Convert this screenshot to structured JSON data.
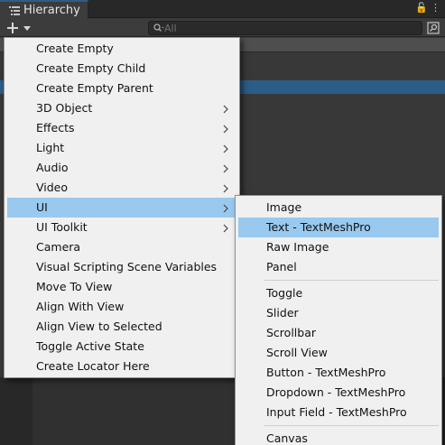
{
  "window": {
    "tab_title": "Hierarchy",
    "lock_symbol": "🔓",
    "more_symbol": "⋮"
  },
  "toolbar": {
    "search_placeholder": "All"
  },
  "colors": {
    "menu_bg": "#f0f0f0",
    "highlight": "#99c9ef",
    "selection_blue": "#2c5d87",
    "editor_bg": "#383838"
  },
  "main_menu": {
    "items": [
      {
        "label": "Create Empty",
        "has_submenu": false
      },
      {
        "label": "Create Empty Child",
        "has_submenu": false
      },
      {
        "label": "Create Empty Parent",
        "has_submenu": false
      },
      {
        "label": "3D Object",
        "has_submenu": true
      },
      {
        "label": "Effects",
        "has_submenu": true
      },
      {
        "label": "Light",
        "has_submenu": true
      },
      {
        "label": "Audio",
        "has_submenu": true
      },
      {
        "label": "Video",
        "has_submenu": true
      },
      {
        "label": "UI",
        "has_submenu": true,
        "highlighted": true
      },
      {
        "label": "UI Toolkit",
        "has_submenu": true
      },
      {
        "label": "Camera",
        "has_submenu": false
      },
      {
        "label": "Visual Scripting Scene Variables",
        "has_submenu": false
      },
      {
        "label": "Move To View",
        "has_submenu": false
      },
      {
        "label": "Align With View",
        "has_submenu": false
      },
      {
        "label": "Align View to Selected",
        "has_submenu": false
      },
      {
        "label": "Toggle Active State",
        "has_submenu": false
      },
      {
        "label": "Create Locator Here",
        "has_submenu": false
      }
    ]
  },
  "ui_submenu": {
    "groups": [
      [
        {
          "label": "Image"
        },
        {
          "label": "Text - TextMeshPro",
          "highlighted": true
        },
        {
          "label": "Raw Image"
        },
        {
          "label": "Panel"
        }
      ],
      [
        {
          "label": "Toggle"
        },
        {
          "label": "Slider"
        },
        {
          "label": "Scrollbar"
        },
        {
          "label": "Scroll View"
        },
        {
          "label": "Button - TextMeshPro"
        },
        {
          "label": "Dropdown - TextMeshPro"
        },
        {
          "label": "Input Field - TextMeshPro"
        }
      ],
      [
        {
          "label": "Canvas"
        }
      ]
    ]
  }
}
